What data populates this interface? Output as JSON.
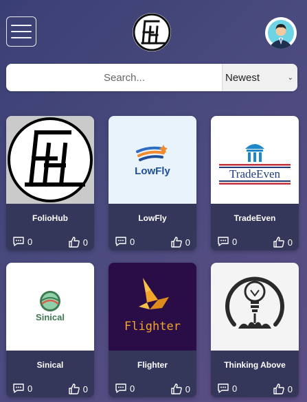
{
  "header": {
    "menu_icon": "hamburger-menu-icon",
    "logo_icon": "foliohub-logo-icon",
    "avatar_icon": "user-avatar-icon"
  },
  "search": {
    "placeholder": "Search...",
    "sort_selected": "Newest"
  },
  "cards": [
    {
      "name": "FolioHub",
      "comments": "0",
      "likes": "0",
      "thumb": "foliohub-logo"
    },
    {
      "name": "LowFly",
      "comments": "0",
      "likes": "0",
      "thumb": "lowfly-logo"
    },
    {
      "name": "TradeEven",
      "comments": "0",
      "likes": "0",
      "thumb": "tradeeven-logo"
    },
    {
      "name": "Sinical",
      "comments": "0",
      "likes": "0",
      "thumb": "sinical-logo"
    },
    {
      "name": "Flighter",
      "comments": "0",
      "likes": "0",
      "thumb": "flighter-logo"
    },
    {
      "name": "Thinking Above",
      "comments": "0",
      "likes": "0",
      "thumb": "thinking-above-logo"
    }
  ],
  "logo_text": {
    "lowfly": "LowFly",
    "tradeeven": "TradeEven",
    "sinical": "Sinical",
    "flighter": "Flighter"
  },
  "colors": {
    "card_info_bg": "#34375a",
    "lowfly_blue": "#1f4f9a",
    "lowfly_orange": "#f08a2c",
    "tradeeven_red": "#c0303a",
    "tradeeven_blue": "#1f3c7a",
    "sinical_green": "#3e7a52",
    "flighter_bg": "#2a0d47",
    "flighter_gold": "#f2a52a"
  }
}
